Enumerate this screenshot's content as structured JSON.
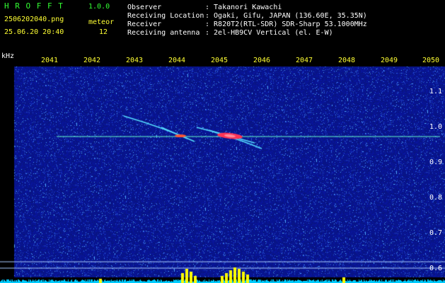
{
  "header": {
    "app_name": "H R O F F T",
    "version": "1.0.0",
    "filename": "2506202040.png",
    "datetime": "25.06.20 20:40",
    "detect_label": "meteor",
    "detect_count": "12",
    "rows": [
      {
        "label": "Observer",
        "value": ": Takanori Kawachi"
      },
      {
        "label": "Receiving Location",
        "value": ": Ogaki, Gifu, JAPAN (136.60E, 35.35N)"
      },
      {
        "label": "Receiver",
        "value": ": R820T2(RTL-SDR) SDR-Sharp 53.1000MHz"
      },
      {
        "label": "Receiving antenna",
        "value": ": 2el-HB9CV Vertical (el. E-W)"
      }
    ]
  },
  "axis": {
    "unit": "kHz",
    "y_ticks": [
      "1.1",
      "1.0",
      "0.9",
      "0.8",
      "0.7",
      "0.6"
    ],
    "x_ticks": [
      "2041",
      "2042",
      "2043",
      "2044",
      "2045",
      "2046",
      "2047",
      "2048",
      "2049",
      "2050"
    ]
  },
  "colors": {
    "background_noise": "#0a1a8c",
    "carrier": "#66ffcc",
    "meteor": "#ff3355",
    "level_bar": "#00ccff",
    "peak_bar": "#ffff00"
  }
}
